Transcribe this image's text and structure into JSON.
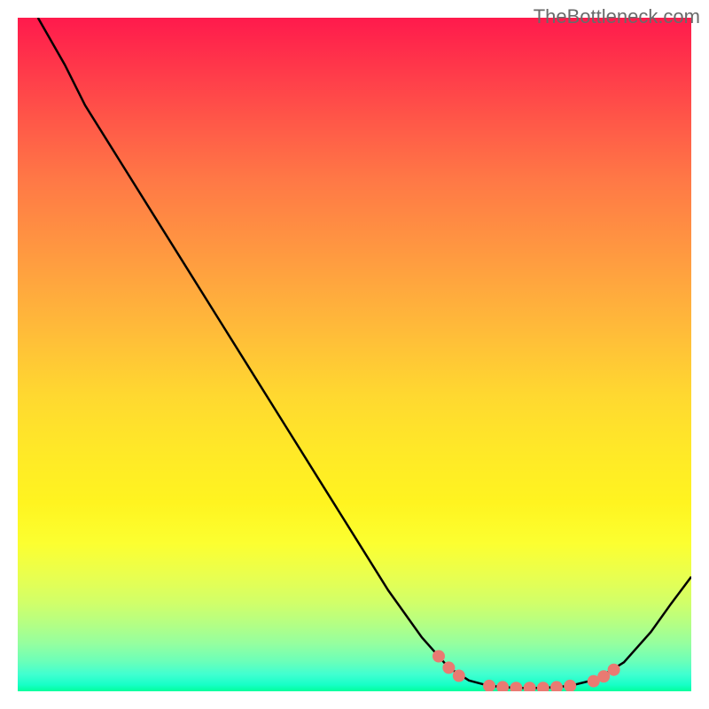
{
  "watermark": "TheBottleneck.com",
  "colors": {
    "curve": "#000000",
    "dots": "#e97a72",
    "watermark_text": "#6a6a6a"
  },
  "chart_data": {
    "type": "line",
    "title": "",
    "xlabel": "",
    "ylabel": "",
    "xlim": [
      0,
      100
    ],
    "ylim": [
      0,
      100
    ],
    "curve": {
      "name": "bottleneck-curve",
      "points": [
        {
          "x": 3,
          "y": 100
        },
        {
          "x": 7,
          "y": 93
        },
        {
          "x": 10,
          "y": 87
        },
        {
          "x": 15,
          "y": 79
        },
        {
          "x": 20,
          "y": 71
        },
        {
          "x": 25,
          "y": 63
        },
        {
          "x": 30,
          "y": 55
        },
        {
          "x": 35,
          "y": 47
        },
        {
          "x": 40,
          "y": 39
        },
        {
          "x": 45,
          "y": 31
        },
        {
          "x": 50,
          "y": 23
        },
        {
          "x": 55,
          "y": 15
        },
        {
          "x": 60,
          "y": 8
        },
        {
          "x": 64,
          "y": 3.5
        },
        {
          "x": 67,
          "y": 1.6
        },
        {
          "x": 70,
          "y": 0.8
        },
        {
          "x": 74,
          "y": 0.5
        },
        {
          "x": 78,
          "y": 0.5
        },
        {
          "x": 82,
          "y": 0.8
        },
        {
          "x": 86,
          "y": 1.8
        },
        {
          "x": 90,
          "y": 4.3
        },
        {
          "x": 94,
          "y": 8.8
        },
        {
          "x": 97,
          "y": 13
        },
        {
          "x": 100,
          "y": 17
        }
      ]
    },
    "highlight_dots": [
      {
        "x": 62.5,
        "y": 5.2
      },
      {
        "x": 64,
        "y": 3.5
      },
      {
        "x": 65.5,
        "y": 2.3
      },
      {
        "x": 70,
        "y": 0.8
      },
      {
        "x": 72,
        "y": 0.6
      },
      {
        "x": 74,
        "y": 0.5
      },
      {
        "x": 76,
        "y": 0.5
      },
      {
        "x": 78,
        "y": 0.5
      },
      {
        "x": 80,
        "y": 0.6
      },
      {
        "x": 82,
        "y": 0.8
      },
      {
        "x": 85.5,
        "y": 1.5
      },
      {
        "x": 87,
        "y": 2.2
      },
      {
        "x": 88.5,
        "y": 3.2
      }
    ]
  }
}
